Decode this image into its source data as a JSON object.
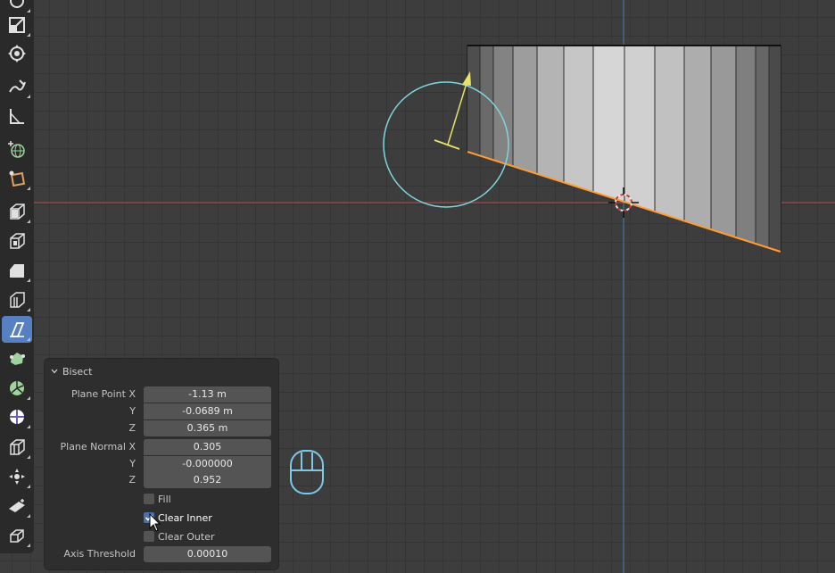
{
  "panel": {
    "title": "Bisect",
    "plane_point": {
      "label_x": "Plane Point X",
      "label_y": "Y",
      "label_z": "Z",
      "x": "-1.13 m",
      "y": "-0.0689 m",
      "z": "0.365 m"
    },
    "plane_normal": {
      "label_x": "Plane Normal X",
      "label_y": "Y",
      "label_z": "Z",
      "x": "0.305",
      "y": "-0.000000",
      "z": "0.952"
    },
    "fill": {
      "label": "Fill",
      "checked": false
    },
    "clear_inner": {
      "label": "Clear Inner",
      "checked": true
    },
    "clear_outer": {
      "label": "Clear Outer",
      "checked": false
    },
    "axis_threshold": {
      "label": "Axis Threshold",
      "value": "0.00010"
    }
  },
  "toolbar": {
    "tools": [
      "rotate-icon",
      "scale-icon",
      "transform-icon",
      "annotate-icon",
      "measure-icon",
      "add-cube-icon",
      "extrude-region-icon",
      "extrude-manifold-icon",
      "inset-faces-icon",
      "bevel-icon",
      "loop-cut-icon",
      "knife-icon",
      "bisect-icon",
      "poly-build-icon",
      "spin-icon",
      "smooth-icon",
      "edge-slide-icon",
      "shrink-fatten-icon",
      "shear-icon",
      "rip-region-icon"
    ],
    "active_tool": "bisect-icon"
  },
  "colors": {
    "viewport_bg": "#3d3d3d",
    "grid": "#353535",
    "x_axis": "#b54a4a",
    "y_axis": "#4a7ab5",
    "bisect_line": "#ff9c33",
    "gizmo_circle": "#7ed6e0",
    "gizmo_arrow": "#e6e36a",
    "active_tool_bg": "#5680c2",
    "checkbox_on": "#4772b3"
  }
}
